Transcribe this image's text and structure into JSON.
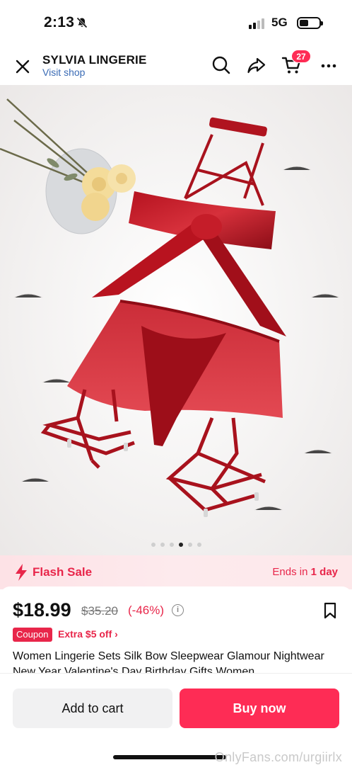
{
  "status_bar": {
    "time": "2:13",
    "network": "5G"
  },
  "header": {
    "shop_name": "SYLVIA LINGERIE",
    "visit_shop": "Visit shop",
    "cart_count": "27",
    "icons": [
      "close-icon",
      "search-icon",
      "share-icon",
      "cart-icon",
      "more-icon"
    ]
  },
  "gallery": {
    "image_count": 6,
    "active_index": 3,
    "image_description": "red satin lingerie set with bow top, tulle skirt and garter straps beside yellow roses"
  },
  "flash_sale": {
    "label": "Flash Sale",
    "ends_prefix": "Ends in",
    "ends_value": "1 day"
  },
  "product": {
    "price": "$18.99",
    "original_price": "$35.20",
    "discount": "(-46%)",
    "coupon_tag": "Coupon",
    "coupon_text": "Extra $5 off ›",
    "title": "Women Lingerie Sets Silk Bow Sleepwear Glamour Nightwear New Year Valentine's Day Birthday Gifts Women..."
  },
  "actions": {
    "add_to_cart": "Add to cart",
    "buy_now": "Buy now"
  },
  "watermark": "OnlyFans.com/urgiirlx",
  "colors": {
    "accent": "#fe2c55",
    "sale_red": "#e8264a",
    "link_blue": "#3a6bb5",
    "flash_bg": "#fde2e6"
  }
}
